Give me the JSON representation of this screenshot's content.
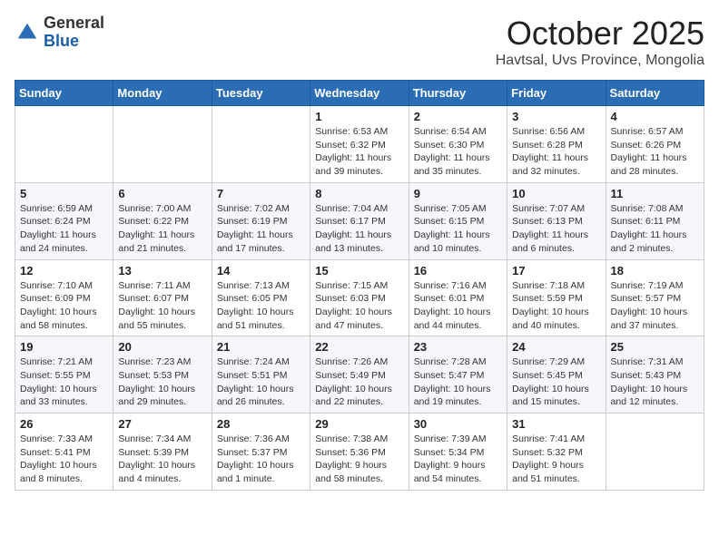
{
  "logo": {
    "general": "General",
    "blue": "Blue"
  },
  "header": {
    "month": "October 2025",
    "location": "Havtsal, Uvs Province, Mongolia"
  },
  "weekdays": [
    "Sunday",
    "Monday",
    "Tuesday",
    "Wednesday",
    "Thursday",
    "Friday",
    "Saturday"
  ],
  "weeks": [
    [
      {
        "day": "",
        "info": ""
      },
      {
        "day": "",
        "info": ""
      },
      {
        "day": "",
        "info": ""
      },
      {
        "day": "1",
        "info": "Sunrise: 6:53 AM\nSunset: 6:32 PM\nDaylight: 11 hours\nand 39 minutes."
      },
      {
        "day": "2",
        "info": "Sunrise: 6:54 AM\nSunset: 6:30 PM\nDaylight: 11 hours\nand 35 minutes."
      },
      {
        "day": "3",
        "info": "Sunrise: 6:56 AM\nSunset: 6:28 PM\nDaylight: 11 hours\nand 32 minutes."
      },
      {
        "day": "4",
        "info": "Sunrise: 6:57 AM\nSunset: 6:26 PM\nDaylight: 11 hours\nand 28 minutes."
      }
    ],
    [
      {
        "day": "5",
        "info": "Sunrise: 6:59 AM\nSunset: 6:24 PM\nDaylight: 11 hours\nand 24 minutes."
      },
      {
        "day": "6",
        "info": "Sunrise: 7:00 AM\nSunset: 6:22 PM\nDaylight: 11 hours\nand 21 minutes."
      },
      {
        "day": "7",
        "info": "Sunrise: 7:02 AM\nSunset: 6:19 PM\nDaylight: 11 hours\nand 17 minutes."
      },
      {
        "day": "8",
        "info": "Sunrise: 7:04 AM\nSunset: 6:17 PM\nDaylight: 11 hours\nand 13 minutes."
      },
      {
        "day": "9",
        "info": "Sunrise: 7:05 AM\nSunset: 6:15 PM\nDaylight: 11 hours\nand 10 minutes."
      },
      {
        "day": "10",
        "info": "Sunrise: 7:07 AM\nSunset: 6:13 PM\nDaylight: 11 hours\nand 6 minutes."
      },
      {
        "day": "11",
        "info": "Sunrise: 7:08 AM\nSunset: 6:11 PM\nDaylight: 11 hours\nand 2 minutes."
      }
    ],
    [
      {
        "day": "12",
        "info": "Sunrise: 7:10 AM\nSunset: 6:09 PM\nDaylight: 10 hours\nand 58 minutes."
      },
      {
        "day": "13",
        "info": "Sunrise: 7:11 AM\nSunset: 6:07 PM\nDaylight: 10 hours\nand 55 minutes."
      },
      {
        "day": "14",
        "info": "Sunrise: 7:13 AM\nSunset: 6:05 PM\nDaylight: 10 hours\nand 51 minutes."
      },
      {
        "day": "15",
        "info": "Sunrise: 7:15 AM\nSunset: 6:03 PM\nDaylight: 10 hours\nand 47 minutes."
      },
      {
        "day": "16",
        "info": "Sunrise: 7:16 AM\nSunset: 6:01 PM\nDaylight: 10 hours\nand 44 minutes."
      },
      {
        "day": "17",
        "info": "Sunrise: 7:18 AM\nSunset: 5:59 PM\nDaylight: 10 hours\nand 40 minutes."
      },
      {
        "day": "18",
        "info": "Sunrise: 7:19 AM\nSunset: 5:57 PM\nDaylight: 10 hours\nand 37 minutes."
      }
    ],
    [
      {
        "day": "19",
        "info": "Sunrise: 7:21 AM\nSunset: 5:55 PM\nDaylight: 10 hours\nand 33 minutes."
      },
      {
        "day": "20",
        "info": "Sunrise: 7:23 AM\nSunset: 5:53 PM\nDaylight: 10 hours\nand 29 minutes."
      },
      {
        "day": "21",
        "info": "Sunrise: 7:24 AM\nSunset: 5:51 PM\nDaylight: 10 hours\nand 26 minutes."
      },
      {
        "day": "22",
        "info": "Sunrise: 7:26 AM\nSunset: 5:49 PM\nDaylight: 10 hours\nand 22 minutes."
      },
      {
        "day": "23",
        "info": "Sunrise: 7:28 AM\nSunset: 5:47 PM\nDaylight: 10 hours\nand 19 minutes."
      },
      {
        "day": "24",
        "info": "Sunrise: 7:29 AM\nSunset: 5:45 PM\nDaylight: 10 hours\nand 15 minutes."
      },
      {
        "day": "25",
        "info": "Sunrise: 7:31 AM\nSunset: 5:43 PM\nDaylight: 10 hours\nand 12 minutes."
      }
    ],
    [
      {
        "day": "26",
        "info": "Sunrise: 7:33 AM\nSunset: 5:41 PM\nDaylight: 10 hours\nand 8 minutes."
      },
      {
        "day": "27",
        "info": "Sunrise: 7:34 AM\nSunset: 5:39 PM\nDaylight: 10 hours\nand 4 minutes."
      },
      {
        "day": "28",
        "info": "Sunrise: 7:36 AM\nSunset: 5:37 PM\nDaylight: 10 hours\nand 1 minute."
      },
      {
        "day": "29",
        "info": "Sunrise: 7:38 AM\nSunset: 5:36 PM\nDaylight: 9 hours\nand 58 minutes."
      },
      {
        "day": "30",
        "info": "Sunrise: 7:39 AM\nSunset: 5:34 PM\nDaylight: 9 hours\nand 54 minutes."
      },
      {
        "day": "31",
        "info": "Sunrise: 7:41 AM\nSunset: 5:32 PM\nDaylight: 9 hours\nand 51 minutes."
      },
      {
        "day": "",
        "info": ""
      }
    ]
  ]
}
